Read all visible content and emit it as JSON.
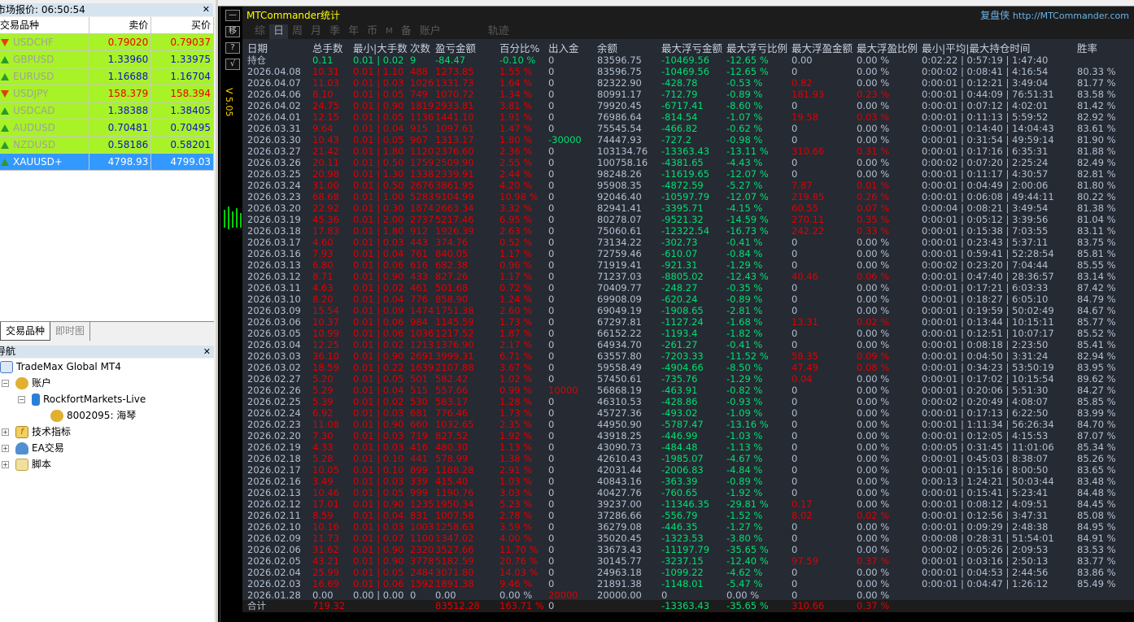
{
  "market_watch": {
    "title": "市场报价: 06:50:54",
    "columns": [
      "交易品种",
      "卖价",
      "买价"
    ],
    "rows": [
      {
        "symbol": "USDCHF",
        "bid": "0.79020",
        "ask": "0.79037",
        "dir": "down"
      },
      {
        "symbol": "GBPUSD",
        "bid": "1.33960",
        "ask": "1.33975",
        "dir": "up"
      },
      {
        "symbol": "EURUSD",
        "bid": "1.16688",
        "ask": "1.16704",
        "dir": "up"
      },
      {
        "symbol": "USDJPY",
        "bid": "158.379",
        "ask": "158.394",
        "dir": "down"
      },
      {
        "symbol": "USDCAD",
        "bid": "1.38388",
        "ask": "1.38405",
        "dir": "up"
      },
      {
        "symbol": "AUDUSD",
        "bid": "0.70481",
        "ask": "0.70495",
        "dir": "up"
      },
      {
        "symbol": "NZDUSD",
        "bid": "0.58186",
        "ask": "0.58201",
        "dir": "up"
      },
      {
        "symbol": "XAUUSD+",
        "bid": "4798.93",
        "ask": "4799.03",
        "dir": "up",
        "selected": true
      }
    ],
    "tabs": [
      "交易品种",
      "即时图"
    ]
  },
  "navigator": {
    "title": "导航",
    "root": "TradeMax Global MT4",
    "accounts": "账户",
    "server": "RockfortMarkets-Live",
    "account": "8002095: 海琴",
    "indicators": "技术指标",
    "experts": "EA交易",
    "scripts": "脚本"
  },
  "toolbar": {
    "buttons": [
      "—",
      "移",
      "?",
      "√"
    ],
    "version": "V 5.05"
  },
  "panel": {
    "title": "MTCommander统计",
    "brand": "复盘侠",
    "url": "http://MTCommander.com",
    "tabs": [
      "综",
      "日",
      "周",
      "月",
      "季",
      "年",
      "币",
      "M",
      "备",
      "账户",
      "轨迹"
    ],
    "active_tab": "日"
  },
  "colors": {
    "red": "#e00000",
    "green": "#00e070",
    "neutral": "#b4c0d0",
    "table_bg": "#252a33",
    "title": "#ffff00"
  },
  "table": {
    "headers": [
      "日期",
      "总手数",
      "最小|大手数",
      "次数",
      "盈亏金额",
      "百分比%",
      "出入金",
      "余额",
      "最大浮亏金额",
      "最大浮亏比例",
      "最大浮盈金额",
      "最大浮盈比例",
      "最小|平均|最大持仓时间",
      "胜率"
    ],
    "holding": [
      "持仓",
      "0.11",
      "0.01 | 0.02",
      "9",
      "-84.47",
      "-0.10 %",
      "0",
      "83596.75",
      "-10469.56",
      "-12.65 %",
      "0.00",
      "0.00 %",
      "0:02:22 | 0:57:19 | 1:47:40",
      ""
    ],
    "rows": [
      [
        "2026.04.08",
        "10.31",
        "0.01 | 1.10",
        "488",
        "1273.85",
        "1.55 %",
        "0",
        "83596.75",
        "-10469.56",
        "-12.65 %",
        "0",
        "0.00 %",
        "0:00:02 | 0:08:41 | 4:16:54",
        "80.33 %"
      ],
      [
        "2026.04.07",
        "11.03",
        "0.01 | 0.03",
        "1026",
        "1331.73",
        "1.64 %",
        "0",
        "82322.90",
        "-428.78",
        "-0.53 %",
        "0.82",
        "0.00 %",
        "0:00:01 | 0:12:21 | 3:49:04",
        "81.77 %"
      ],
      [
        "2026.04.06",
        "8.10",
        "0.01 | 0.05",
        "749",
        "1070.72",
        "1.34 %",
        "0",
        "80991.17",
        "-712.79",
        "-0.89 %",
        "181.93",
        "0.23 %",
        "0:00:01 | 0:44:09 | 76:51:31",
        "83.58 %"
      ],
      [
        "2026.04.02",
        "24.75",
        "0.01 | 0.90",
        "1819",
        "2933.81",
        "3.81 %",
        "0",
        "79920.45",
        "-6717.41",
        "-8.60 %",
        "0",
        "0.00 %",
        "0:00:01 | 0:07:12 | 4:02:01",
        "81.42 %"
      ],
      [
        "2026.04.01",
        "12.15",
        "0.01 | 0.05",
        "1136",
        "1441.10",
        "1.91 %",
        "0",
        "76986.64",
        "-814.54",
        "-1.07 %",
        "19.58",
        "0.03 %",
        "0:00:01 | 0:11:13 | 5:59:52",
        "82.92 %"
      ],
      [
        "2026.03.31",
        "9.64",
        "0.01 | 0.04",
        "915",
        "1097.61",
        "1.47 %",
        "0",
        "75545.54",
        "-466.82",
        "-0.62 %",
        "0",
        "0.00 %",
        "0:00:01 | 0:14:40 | 14:04:43",
        "83.61 %"
      ],
      [
        "2026.03.30",
        "10.43",
        "0.01 | 0.05",
        "967",
        "1313.17",
        "1.80 %",
        "-30000",
        "74447.93",
        "-727.2",
        "-0.98 %",
        "0",
        "0.00 %",
        "0:00:01 | 0:31:54 | 49:59:14",
        "81.90 %"
      ],
      [
        "2026.03.27",
        "21.42",
        "0.01 | 1.80",
        "1120",
        "2376.60",
        "2.36 %",
        "0",
        "103134.76",
        "-13363.43",
        "-13.11 %",
        "310.66",
        "0.31 %",
        "0:00:01 | 0:17:16 | 6:35:31",
        "81.88 %"
      ],
      [
        "2026.03.26",
        "20.11",
        "0.01 | 0.50",
        "1759",
        "2509.90",
        "2.55 %",
        "0",
        "100758.16",
        "-4381.65",
        "-4.43 %",
        "0",
        "0.00 %",
        "0:00:02 | 0:07:20 | 2:25:24",
        "82.49 %"
      ],
      [
        "2026.03.25",
        "20.98",
        "0.01 | 1.30",
        "1338",
        "2339.91",
        "2.44 %",
        "0",
        "98248.26",
        "-11619.65",
        "-12.07 %",
        "0",
        "0.00 %",
        "0:00:01 | 0:11:17 | 4:30:57",
        "82.81 %"
      ],
      [
        "2026.03.24",
        "31.00",
        "0.01 | 0.50",
        "2676",
        "3861.95",
        "4.20 %",
        "0",
        "95908.35",
        "-4872.59",
        "-5.27 %",
        "7.87",
        "0.01 %",
        "0:00:01 | 0:04:49 | 2:00:06",
        "81.80 %"
      ],
      [
        "2026.03.23",
        "68.68",
        "0.01 | 1.00",
        "5283",
        "9104.99",
        "10.98 %",
        "0",
        "92046.40",
        "-10597.79",
        "-12.07 %",
        "219.85",
        "0.26 %",
        "0:00:01 | 0:06:08 | 49:44:11",
        "80.22 %"
      ],
      [
        "2026.03.20",
        "22.92",
        "0.01 | 0.30",
        "1874",
        "2663.34",
        "3.32 %",
        "0",
        "82941.41",
        "-3395.71",
        "-4.15 %",
        "60.55",
        "0.07 %",
        "0:00:04 | 0:08:21 | 3:49:54",
        "81.38 %"
      ],
      [
        "2026.03.19",
        "45.36",
        "0.01 | 2.00",
        "2737",
        "5217.46",
        "6.95 %",
        "0",
        "80278.07",
        "-9521.32",
        "-14.59 %",
        "270.11",
        "0.35 %",
        "0:00:01 | 0:05:12 | 3:39:56",
        "81.04 %"
      ],
      [
        "2026.03.18",
        "17.83",
        "0.01 | 1.80",
        "912",
        "1926.39",
        "2.63 %",
        "0",
        "75060.61",
        "-12322.54",
        "-16.73 %",
        "242.22",
        "0.33 %",
        "0:00:01 | 0:15:38 | 7:03:55",
        "83.11 %"
      ],
      [
        "2026.03.17",
        "4.60",
        "0.01 | 0.03",
        "443",
        "374.76",
        "0.52 %",
        "0",
        "73134.22",
        "-302.73",
        "-0.41 %",
        "0",
        "0.00 %",
        "0:00:01 | 0:23:43 | 5:37:11",
        "83.75 %"
      ],
      [
        "2026.03.16",
        "7.93",
        "0.01 | 0.04",
        "761",
        "840.05",
        "1.17 %",
        "0",
        "72759.46",
        "-610.07",
        "-0.84 %",
        "0",
        "0.00 %",
        "0:00:01 | 0:59:41 | 52:28:54",
        "85.81 %"
      ],
      [
        "2026.03.13",
        "6.80",
        "0.01 | 0.06",
        "616",
        "682.38",
        "0.96 %",
        "0",
        "71919.41",
        "-921.31",
        "-1.29 %",
        "0",
        "0.00 %",
        "0:00:02 | 0:23:20 | 7:04:44",
        "85.55 %"
      ],
      [
        "2026.03.12",
        "8.71",
        "0.01 | 0.90",
        "433",
        "827.26",
        "1.17 %",
        "0",
        "71237.03",
        "-8805.02",
        "-12.43 %",
        "40.46",
        "0.06 %",
        "0:00:01 | 0:47:40 | 28:36:57",
        "83.14 %"
      ],
      [
        "2026.03.11",
        "4.63",
        "0.01 | 0.02",
        "461",
        "501.68",
        "0.72 %",
        "0",
        "70409.77",
        "-248.27",
        "-0.35 %",
        "0",
        "0.00 %",
        "0:00:01 | 0:17:21 | 6:03:33",
        "87.42 %"
      ],
      [
        "2026.03.10",
        "8.20",
        "0.01 | 0.04",
        "776",
        "858.90",
        "1.24 %",
        "0",
        "69908.09",
        "-620.24",
        "-0.89 %",
        "0",
        "0.00 %",
        "0:00:01 | 0:18:27 | 6:05:10",
        "84.79 %"
      ],
      [
        "2026.03.09",
        "15.54",
        "0.01 | 0.09",
        "1474",
        "1751.38",
        "2.60 %",
        "0",
        "69049.19",
        "-1908.65",
        "-2.81 %",
        "0",
        "0.00 %",
        "0:00:01 | 0:19:59 | 50:02:49",
        "84.67 %"
      ],
      [
        "2026.03.06",
        "10.37",
        "0.01 | 0.06",
        "984",
        "1145.59",
        "1.73 %",
        "0",
        "67297.81",
        "-1127.24",
        "-1.68 %",
        "13.31",
        "0.02 %",
        "0:00:01 | 0:13:44 | 10:15:11",
        "85.77 %"
      ],
      [
        "2026.03.05",
        "10.99",
        "0.01 | 0.06",
        "1036",
        "1217.52",
        "1.87 %",
        "0",
        "66152.22",
        "-1193.4",
        "-1.82 %",
        "0",
        "0.00 %",
        "0:00:01 | 0:12:51 | 10:07:17",
        "85.52 %"
      ],
      [
        "2026.03.04",
        "12.25",
        "0.01 | 0.02",
        "1213",
        "1376.90",
        "2.17 %",
        "0",
        "64934.70",
        "-261.27",
        "-0.41 %",
        "0",
        "0.00 %",
        "0:00:01 | 0:08:18 | 2:23:50",
        "85.41 %"
      ],
      [
        "2026.03.03",
        "36.10",
        "0.01 | 0.90",
        "2691",
        "3999.31",
        "6.71 %",
        "0",
        "63557.80",
        "-7203.33",
        "-11.52 %",
        "58.35",
        "0.09 %",
        "0:00:01 | 0:04:50 | 3:31:24",
        "82.94 %"
      ],
      [
        "2026.03.02",
        "18.59",
        "0.01 | 0.22",
        "1639",
        "2107.88",
        "3.67 %",
        "0",
        "59558.49",
        "-4904.66",
        "-8.50 %",
        "47.49",
        "0.08 %",
        "0:00:01 | 0:34:23 | 53:50:19",
        "83.95 %"
      ],
      [
        "2026.02.27",
        "5.20",
        "0.01 | 0.05",
        "501",
        "582.42",
        "1.02 %",
        "0",
        "57450.61",
        "-735.76",
        "-1.29 %",
        "0.04",
        "0.00 %",
        "0:00:01 | 0:17:02 | 10:15:54",
        "89.62 %"
      ],
      [
        "2026.02.26",
        "5.29",
        "0.01 | 0.04",
        "515",
        "557.66",
        "0.99 %",
        "10000",
        "56868.19",
        "-463.91",
        "-0.82 %",
        "0",
        "0.00 %",
        "0:00:01 | 0:20:06 | 5:51:30",
        "84.27 %"
      ],
      [
        "2026.02.25",
        "5.39",
        "0.01 | 0.02",
        "530",
        "583.17",
        "1.28 %",
        "0",
        "46310.53",
        "-428.86",
        "-0.93 %",
        "0",
        "0.00 %",
        "0:00:02 | 0:20:49 | 4:08:07",
        "85.85 %"
      ],
      [
        "2026.02.24",
        "6.92",
        "0.01 | 0.03",
        "681",
        "776.46",
        "1.73 %",
        "0",
        "45727.36",
        "-493.02",
        "-1.09 %",
        "0",
        "0.00 %",
        "0:00:01 | 0:17:13 | 6:22:50",
        "83.99 %"
      ],
      [
        "2026.02.23",
        "11.08",
        "0.01 | 0.90",
        "660",
        "1032.65",
        "2.35 %",
        "0",
        "44950.90",
        "-5787.47",
        "-13.16 %",
        "0",
        "0.00 %",
        "0:00:01 | 1:11:34 | 56:26:34",
        "84.70 %"
      ],
      [
        "2026.02.20",
        "7.30",
        "0.01 | 0.03",
        "719",
        "827.52",
        "1.92 %",
        "0",
        "43918.25",
        "-446.99",
        "-1.03 %",
        "0",
        "0.00 %",
        "0:00:01 | 0:12:05 | 4:15:53",
        "87.07 %"
      ],
      [
        "2026.02.19",
        "4.33",
        "0.01 | 0.03",
        "416",
        "480.30",
        "1.13 %",
        "0",
        "43090.73",
        "-484.48",
        "-1.13 %",
        "0",
        "0.00 %",
        "0:00:05 | 0:31:45 | 11:01:06",
        "85.34 %"
      ],
      [
        "2026.02.18",
        "5.28",
        "0.01 | 0.10",
        "441",
        "578.99",
        "1.38 %",
        "0",
        "42610.43",
        "-1985.07",
        "-4.67 %",
        "0",
        "0.00 %",
        "0:00:01 | 0:45:03 | 8:38:07",
        "85.26 %"
      ],
      [
        "2026.02.17",
        "10.05",
        "0.01 | 0.10",
        "899",
        "1188.28",
        "2.91 %",
        "0",
        "42031.44",
        "-2006.83",
        "-4.84 %",
        "0",
        "0.00 %",
        "0:00:01 | 0:15:16 | 8:00:50",
        "83.65 %"
      ],
      [
        "2026.02.16",
        "3.49",
        "0.01 | 0.03",
        "339",
        "415.40",
        "1.03 %",
        "0",
        "40843.16",
        "-363.39",
        "-0.89 %",
        "0",
        "0.00 %",
        "0:00:13 | 1:24:21 | 50:03:44",
        "83.48 %"
      ],
      [
        "2026.02.13",
        "10.46",
        "0.01 | 0.05",
        "999",
        "1190.76",
        "3.03 %",
        "0",
        "40427.76",
        "-760.65",
        "-1.92 %",
        "0",
        "0.00 %",
        "0:00:01 | 0:15:41 | 5:23:41",
        "84.48 %"
      ],
      [
        "2026.02.12",
        "17.01",
        "0.01 | 0.90",
        "1235",
        "1950.34",
        "5.23 %",
        "0",
        "39237.00",
        "-11346.35",
        "-29.81 %",
        "0.17",
        "0.00 %",
        "0:00:01 | 0:08:12 | 4:09:51",
        "84.45 %"
      ],
      [
        "2026.02.11",
        "8.59",
        "0.01 | 0.04",
        "831",
        "1007.58",
        "2.78 %",
        "0",
        "37286.66",
        "-556.79",
        "-1.52 %",
        "8.02",
        "0.02 %",
        "0:00:01 | 0:12:56 | 3:47:31",
        "85.08 %"
      ],
      [
        "2026.02.10",
        "10.16",
        "0.01 | 0.03",
        "1003",
        "1258.63",
        "3.59 %",
        "0",
        "36279.08",
        "-446.35",
        "-1.27 %",
        "0",
        "0.00 %",
        "0:00:01 | 0:09:29 | 2:48:38",
        "84.95 %"
      ],
      [
        "2026.02.09",
        "11.73",
        "0.01 | 0.07",
        "1100",
        "1347.02",
        "4.00 %",
        "0",
        "35020.45",
        "-1323.53",
        "-3.80 %",
        "0",
        "0.00 %",
        "0:00:08 | 0:28:31 | 51:54:01",
        "84.91 %"
      ],
      [
        "2026.02.06",
        "31.62",
        "0.01 | 0.90",
        "2320",
        "3527.66",
        "11.70 %",
        "0",
        "33673.43",
        "-11197.79",
        "-35.65 %",
        "0",
        "0.00 %",
        "0:00:02 | 0:05:26 | 2:09:53",
        "83.53 %"
      ],
      [
        "2026.02.05",
        "43.21",
        "0.01 | 0.90",
        "3778",
        "5182.59",
        "20.76 %",
        "0",
        "30145.77",
        "-3237.15",
        "-12.40 %",
        "97.59",
        "0.37 %",
        "0:00:01 | 0:03:16 | 2:50:13",
        "83.77 %"
      ],
      [
        "2026.02.04",
        "25.99",
        "0.01 | 0.05",
        "2484",
        "3071.80",
        "14.03 %",
        "0",
        "24963.18",
        "-1099.22",
        "-4.62 %",
        "0",
        "0.00 %",
        "0:00:01 | 0:04:53 | 2:44:56",
        "83.86 %"
      ],
      [
        "2026.02.03",
        "16.69",
        "0.01 | 0.06",
        "1592",
        "1891.38",
        "9.46 %",
        "0",
        "21891.38",
        "-1148.01",
        "-5.47 %",
        "0",
        "0.00 %",
        "0:00:01 | 0:04:47 | 1:26:12",
        "85.49 %"
      ],
      [
        "2026.01.28",
        "0.00",
        "0.00 | 0.00",
        "0",
        "0.00",
        "0.00 %",
        "20000",
        "20000.00",
        "0",
        "0.00 %",
        "0",
        "0.00 %",
        "",
        ""
      ]
    ],
    "total": [
      "合计",
      "719.32",
      "",
      "",
      "83512.28",
      "163.71 %",
      "0",
      "",
      "-13363.43",
      "-35.65 %",
      "310.66",
      "0.37 %",
      "",
      ""
    ]
  }
}
